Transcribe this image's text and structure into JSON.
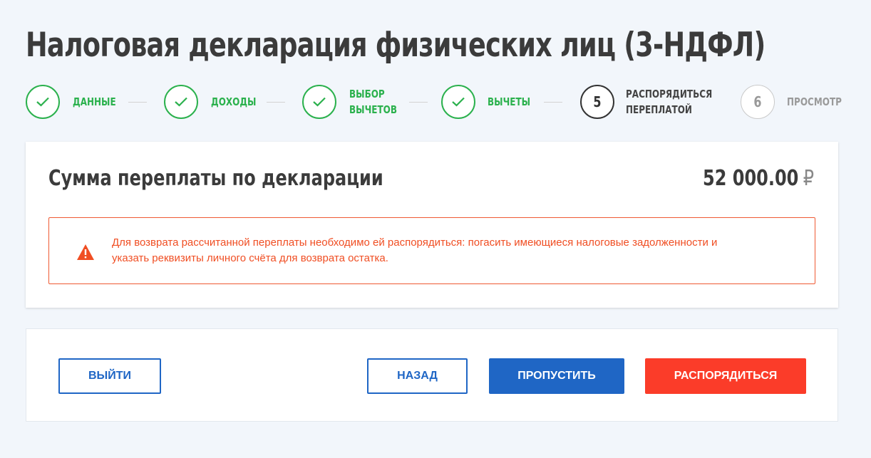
{
  "page": {
    "title": "Налоговая декларация физических лиц (3-НДФЛ)"
  },
  "stepper": {
    "steps": [
      {
        "label": "Данные",
        "status": "done",
        "icon": "check-icon"
      },
      {
        "label": "Доходы",
        "status": "done",
        "icon": "check-icon"
      },
      {
        "label": "Выбор вычетов",
        "line1": "Выбор",
        "line2": "вычетов",
        "status": "done",
        "icon": "check-icon"
      },
      {
        "label": "Вычеты",
        "status": "done",
        "icon": "check-icon"
      },
      {
        "number": "5",
        "label": "Распорядиться переплатой",
        "line1": "Распорядиться",
        "line2": "переплатой",
        "status": "active"
      },
      {
        "number": "6",
        "label": "Просмотр",
        "status": "future"
      }
    ]
  },
  "summary": {
    "label": "Сумма переплаты по декларации",
    "amount": "52 000.00",
    "currency": "₽"
  },
  "alert": {
    "icon": "warning-icon",
    "line1": "Для возврата рассчитанной переплаты необходимо ей распорядиться: погасить имеющиеся налоговые задолженности и",
    "line2": "указать реквизиты личного счёта для возврата остатка."
  },
  "actions": {
    "exit_label": "Выйти",
    "back_label": "Назад",
    "skip_label": "Пропустить",
    "dispose_label": "Распорядиться"
  },
  "colors": {
    "success": "#2bb14d",
    "primary": "#1f66c5",
    "danger": "#fb3c29",
    "warning_text": "#f04e23"
  }
}
